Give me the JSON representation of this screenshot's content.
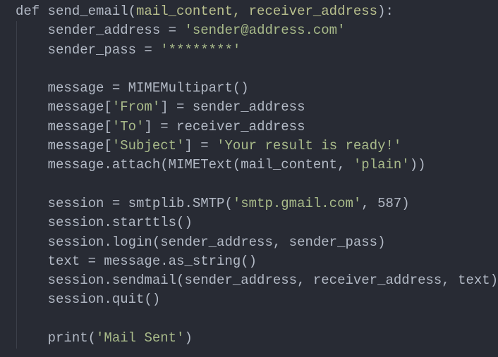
{
  "colors": {
    "background": "#282b34",
    "text": "#b3bac6",
    "string": "#a9bb8a",
    "param": "#b9c08e"
  },
  "code_lines": [
    [
      [
        "def send_email(",
        "plain"
      ],
      [
        "mail_content, receiver_address",
        "param"
      ],
      [
        "):",
        "plain"
      ]
    ],
    [
      [
        "    sender_address = ",
        "plain"
      ],
      [
        "'sender@address.com'",
        "str"
      ]
    ],
    [
      [
        "    sender_pass = ",
        "plain"
      ],
      [
        "'********'",
        "str"
      ]
    ],
    [],
    [
      [
        "    message = MIMEMultipart()",
        "plain"
      ]
    ],
    [
      [
        "    message[",
        "plain"
      ],
      [
        "'From'",
        "str"
      ],
      [
        "] = sender_address",
        "plain"
      ]
    ],
    [
      [
        "    message[",
        "plain"
      ],
      [
        "'To'",
        "str"
      ],
      [
        "] = receiver_address",
        "plain"
      ]
    ],
    [
      [
        "    message[",
        "plain"
      ],
      [
        "'Subject'",
        "str"
      ],
      [
        "] = ",
        "plain"
      ],
      [
        "'Your result is ready!'",
        "str"
      ]
    ],
    [
      [
        "    message.attach(MIMEText(mail_content, ",
        "plain"
      ],
      [
        "'plain'",
        "str"
      ],
      [
        "))",
        "plain"
      ]
    ],
    [],
    [
      [
        "    session = smtplib.SMTP(",
        "plain"
      ],
      [
        "'smtp.gmail.com'",
        "str"
      ],
      [
        ", 587)",
        "plain"
      ]
    ],
    [
      [
        "    session.starttls()",
        "plain"
      ]
    ],
    [
      [
        "    session.login(sender_address, sender_pass)",
        "plain"
      ]
    ],
    [
      [
        "    text = message.as_string()",
        "plain"
      ]
    ],
    [
      [
        "    session.sendmail(sender_address, receiver_address, text)",
        "plain"
      ]
    ],
    [
      [
        "    session.quit()",
        "plain"
      ]
    ],
    [],
    [
      [
        "    print(",
        "plain"
      ],
      [
        "'Mail Sent'",
        "str"
      ],
      [
        ")",
        "plain"
      ]
    ]
  ]
}
